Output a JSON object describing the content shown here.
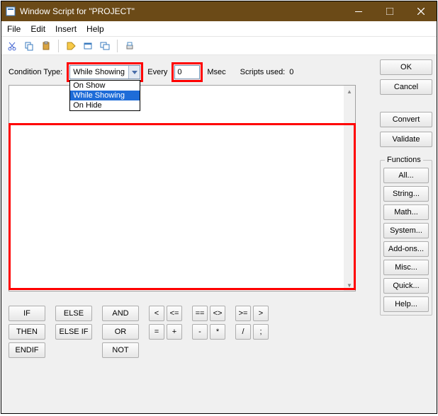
{
  "window": {
    "title": "Window Script for \"PROJECT\""
  },
  "menu": {
    "file": "File",
    "edit": "Edit",
    "insert": "Insert",
    "help": "Help"
  },
  "row1": {
    "condition_label": "Condition Type:",
    "condition_value": "While Showing",
    "options": {
      "on_show": "On Show",
      "while_showing": "While Showing",
      "on_hide": "On Hide"
    },
    "every_label": "Every",
    "every_value": "0",
    "msec_label": "Msec",
    "scripts_used_label": "Scripts used:",
    "scripts_used_value": "0"
  },
  "right": {
    "ok": "OK",
    "cancel": "Cancel",
    "convert": "Convert",
    "validate": "Validate",
    "functions_label": "Functions",
    "all": "All...",
    "string": "String...",
    "math": "Math...",
    "system": "System...",
    "addons": "Add-ons...",
    "misc": "Misc...",
    "quick": "Quick...",
    "help": "Help..."
  },
  "keys": {
    "if": "IF",
    "else": "ELSE",
    "and": "AND",
    "then": "THEN",
    "elseif": "ELSE IF",
    "or": "OR",
    "endif": "ENDIF",
    "not": "NOT",
    "lt": "<",
    "le": "<=",
    "eq_eq": "==",
    "ne": "<>",
    "ge": ">=",
    "gt": ">",
    "eq": "=",
    "plus": "+",
    "minus": "-",
    "star": "*",
    "slash": "/",
    "semi": ";"
  }
}
